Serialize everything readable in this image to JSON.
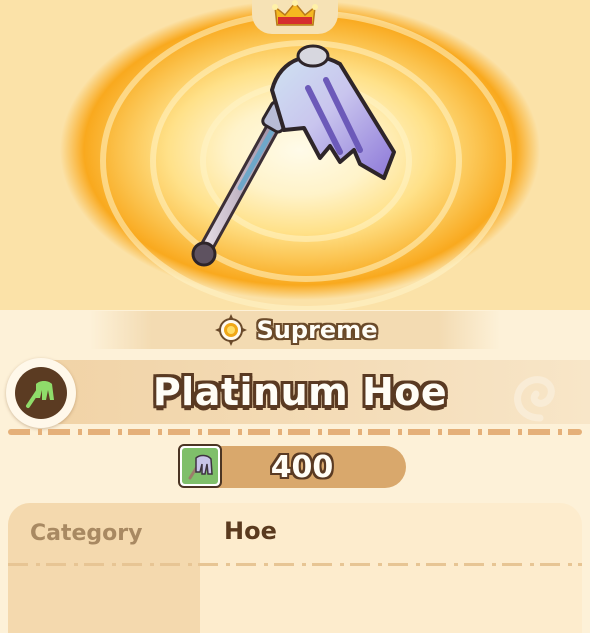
{
  "item": {
    "rarity": "Supreme",
    "name": "Platinum Hoe",
    "price": "400"
  },
  "details": {
    "rows": [
      {
        "label": "Category",
        "value": "Hoe"
      }
    ]
  },
  "icons": {
    "top_badge": "crown-icon",
    "rarity": "supreme-rarity-icon",
    "category": "hoe-category-icon",
    "price": "hoe-price-icon"
  },
  "colors": {
    "glow": "#f9a91e",
    "title_outline": "#5a3a22",
    "price_pill": "#d9a86c",
    "category_icon_green": "#8fdc6a"
  }
}
